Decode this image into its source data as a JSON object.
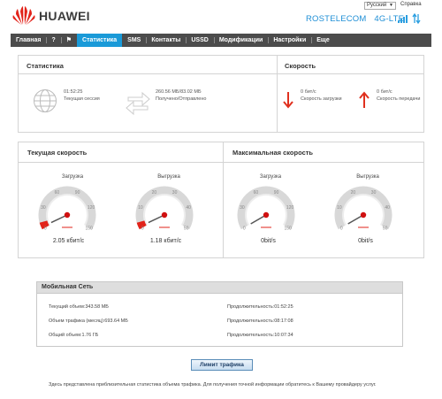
{
  "header": {
    "brand": "HUAWEI",
    "language": "Русский",
    "help": "Справка",
    "operator": "ROSTELECOM",
    "network_type": "4G-LTE"
  },
  "nav": {
    "items": [
      {
        "label": "Главная"
      },
      {
        "label": "?"
      },
      {
        "label": "⚑"
      },
      {
        "label": "Статистика",
        "active": true
      },
      {
        "label": "SMS"
      },
      {
        "label": "Контакты"
      },
      {
        "label": "USSD"
      },
      {
        "label": "Модификации"
      },
      {
        "label": "Настройки"
      },
      {
        "label": "Еще"
      }
    ]
  },
  "statistics": {
    "title": "Статистика",
    "session_time": "01:52:25",
    "session_label": "Текущая сессия",
    "traffic": "260.56 МБ/83.02 МБ",
    "traffic_label": "Получено/Отправлено"
  },
  "speed": {
    "title": "Скорость",
    "download_value": "0 бит/с",
    "download_label": "Скорость загрузки",
    "upload_value": "0 бит/с",
    "upload_label": "Скорость передачи"
  },
  "current_speed": {
    "title": "Текущая скорость",
    "download": {
      "label": "Загрузка",
      "value": "2.05 кбит/с",
      "ticks": [
        "0",
        "30",
        "60",
        "90",
        "120",
        "150"
      ],
      "fraction": 0.02
    },
    "upload": {
      "label": "Выгрузка",
      "value": "1.18 кбит/с",
      "ticks": [
        "0",
        "10",
        "20",
        "30",
        "40",
        "50"
      ],
      "fraction": 0.02
    }
  },
  "max_speed": {
    "title": "Максимальная скорость",
    "download": {
      "label": "Загрузка",
      "value": "0bit/s",
      "ticks": [
        "0",
        "30",
        "60",
        "90",
        "120",
        "150"
      ],
      "fraction": 0.0
    },
    "upload": {
      "label": "Выгрузка",
      "value": "0bit/s",
      "ticks": [
        "0",
        "10",
        "20",
        "30",
        "40",
        "50"
      ],
      "fraction": 0.0
    }
  },
  "mobile_network": {
    "title": "Мобильная Сеть",
    "rows": [
      {
        "left": "Текущий объем:343.58 МБ",
        "right": "Продолжительность:01:52:25"
      },
      {
        "left": "Объем трафика (месяц):693.64 МБ",
        "right": "Продолжительность:08:17:08"
      },
      {
        "left": "Общий объем:1.76 ГБ",
        "right": "Продолжительность:10:07:34"
      }
    ]
  },
  "limit_button": "Лимит трафика",
  "footer_note": "Здесь представлена приблизительная статистика объема трафика. Для получения точной информации обратитесь к Вашему провайдеру услуг.",
  "colors": {
    "accent": "#1a9ad8",
    "nav_bg": "#4c4c4c",
    "brand_red": "#e2231a",
    "arrow_red": "#e0301e"
  }
}
